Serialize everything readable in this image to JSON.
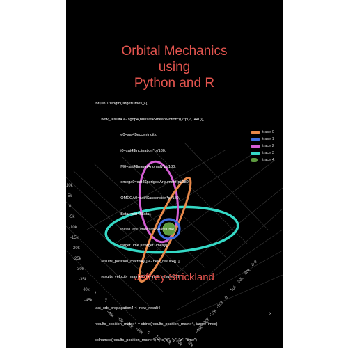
{
  "book": {
    "title_lines": [
      "Orbital Mechanics",
      "using",
      "Python and R"
    ],
    "author": "Jeffrey Strickland",
    "code_lines": [
      "for(i in 1:length(targetTimes)) {",
      "      new_result4 <- sgdp4(n0=sat4$meanMotion*((2*pi)/(1440)),",
      "                        e0=sat4$eccentricity,",
      "                        i0=sat4$inclination*pi/180,",
      "                        M0=sat4$meanAnomaly*pi/180,",
      "                        omega0=sat4$perigeeArgument*pi/180,",
      "                        OMEGA0=sat4$ascension*pi/180,",
      "                        Bstar=sat4$Bstar,",
      "                        initialDateTime=sat4$dateTime,",
      "                        targetTime = targetTimes[i])",
      "      results_position_matrix4[i,] <- new_result4[[1]]",
      "      results_velocity_matrix4[i,] <- new_result4[[2]]",
      "}",
      "last_orb_propagation4 <- new_result4",
      "results_position_matrix4 = cbind(results_position_matrix4, targetTimes)",
      "colnames(results_position_matrix4) <- c(\"x\", \"y\", \"z\", \"time\")"
    ]
  },
  "legend": [
    {
      "label": "trace 0",
      "color": "#e8894a"
    },
    {
      "label": "trace 1",
      "color": "#3f6de0"
    },
    {
      "label": "trace 2",
      "color": "#d55ed5"
    },
    {
      "label": "trace 3",
      "color": "#35d9c6"
    },
    {
      "label": "trace 4",
      "color": "#5d9b3f"
    }
  ],
  "axis_ticks": {
    "left": [
      "10k",
      "5k",
      "0",
      "-5k",
      "-10k",
      "-15k",
      "-20k",
      "-25k",
      "-30k",
      "-35k",
      "-40k",
      "-45k"
    ],
    "bottom": [
      "-40k",
      "-30k",
      "-20k",
      "-10k",
      "0",
      "10k",
      "20k",
      "30k",
      "40k"
    ],
    "right": [
      "40k",
      "30k",
      "20k",
      "10k",
      "0",
      "-10k",
      "-20k",
      "-30k",
      "-40k"
    ]
  },
  "axis_titles": {
    "left": "y",
    "right": "x"
  },
  "colors": {
    "background": "#000000",
    "title": "#e2544e",
    "code": "#ffffff"
  }
}
